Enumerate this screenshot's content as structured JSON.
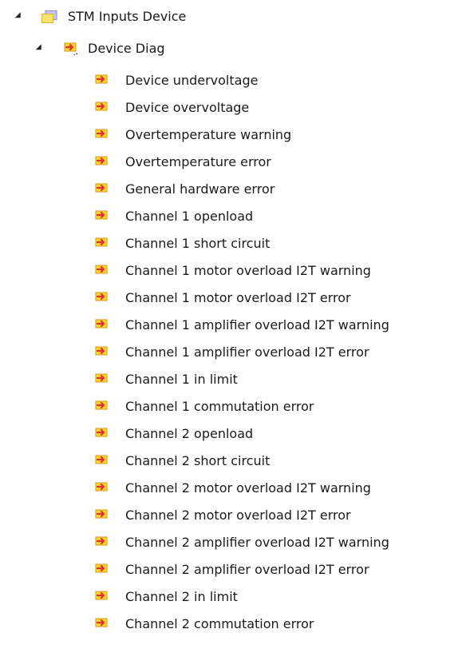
{
  "root": {
    "label": "STM Inputs Device",
    "icon": "folder-icon",
    "expanded": true,
    "children": [
      {
        "label": "Device Diag",
        "icon": "input-variable-group-icon",
        "expanded": true,
        "items": [
          "Device undervoltage",
          "Device overvoltage",
          "Overtemperature warning",
          "Overtemperature error",
          "General hardware error",
          "Channel 1 openload",
          "Channel 1 short circuit",
          "Channel 1 motor overload I2T warning",
          "Channel 1 motor overload I2T error",
          "Channel 1 amplifier overload I2T warning",
          "Channel 1 amplifier overload I2T error",
          "Channel 1 in limit",
          "Channel 1 commutation error",
          "Channel 2 openload",
          "Channel 2 short circuit",
          "Channel 2 motor overload I2T warning",
          "Channel 2 motor overload I2T error",
          "Channel 2 amplifier overload I2T warning",
          "Channel 2 amplifier overload I2T error",
          "Channel 2 in limit",
          "Channel 2 commutation error"
        ]
      }
    ]
  },
  "colors": {
    "folder_fill": "#f8e36b",
    "folder_border": "#d6b63a",
    "folder_screen": "#c7c7f0",
    "variable_fill": "#ffd633",
    "variable_arrow": "#e0342a",
    "variable_border": "#d49a12",
    "text": "#1a1a1a",
    "expander": "#262626"
  }
}
